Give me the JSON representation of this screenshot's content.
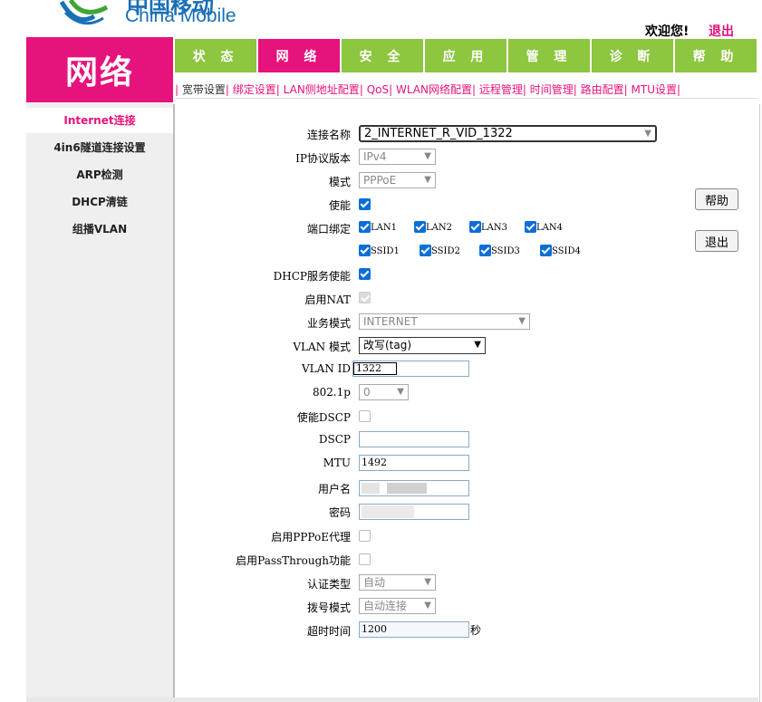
{
  "brand": {
    "cn": "中国移动",
    "en": "China Mobile"
  },
  "user": {
    "welcome": "欢迎您!",
    "logout": "退出"
  },
  "page_badge": "网络",
  "topnav": [
    "状 态",
    "网 络",
    "安 全",
    "应 用",
    "管 理",
    "诊 断",
    "帮 助"
  ],
  "subnav": [
    "宽带设置",
    "绑定设置",
    "LAN侧地址配置",
    "QoS",
    "WLAN网络配置",
    "远程管理",
    "时间管理",
    "路由配置",
    "MTU设置"
  ],
  "sidebar": [
    "Internet连接",
    "4in6隧道连接设置",
    "ARP检测",
    "DHCP清链",
    "组播VLAN"
  ],
  "form": {
    "conn_name_label": "连接名称",
    "conn_name_value": "2_INTERNET_R_VID_1322",
    "ip_version_label": "IP协议版本",
    "ip_version_value": "IPv4",
    "mode_label": "模式",
    "mode_value": "PPPoE",
    "enable_label": "使能",
    "port_bind_label": "端口绑定",
    "ports": [
      "LAN1",
      "LAN2",
      "LAN3",
      "LAN4"
    ],
    "ssids": [
      "SSID1",
      "SSID2",
      "SSID3",
      "SSID4"
    ],
    "dhcp_label": "DHCP服务使能",
    "nat_label": "启用NAT",
    "service_mode_label": "业务模式",
    "service_mode_value": "INTERNET",
    "vlan_mode_label": "VLAN 模式",
    "vlan_mode_value": "改写(tag)",
    "vlan_id_label": "VLAN ID",
    "vlan_id_value": "1322",
    "dot1p_label": "802.1p",
    "dot1p_value": "0",
    "dscp_enable_label": "使能DSCP",
    "dscp_label": "DSCP",
    "dscp_value": "",
    "mtu_label": "MTU",
    "mtu_value": "1492",
    "username_label": "用户名",
    "password_label": "密码",
    "pppoe_proxy_label": "启用PPPoE代理",
    "passthrough_label": "启用PassThrough功能",
    "auth_type_label": "认证类型",
    "auth_type_value": "自动",
    "dial_mode_label": "拨号模式",
    "dial_mode_value": "自动连接",
    "timeout_label": "超时时间",
    "timeout_value": "1200",
    "timeout_unit": "秒"
  },
  "buttons": {
    "help": "帮助",
    "exit": "退出"
  },
  "colors": {
    "brand_pink": "#e6137c",
    "nav_green": "#8dc63f",
    "check_blue": "#0a6fd6",
    "logo_blue": "#1a6fb5"
  }
}
